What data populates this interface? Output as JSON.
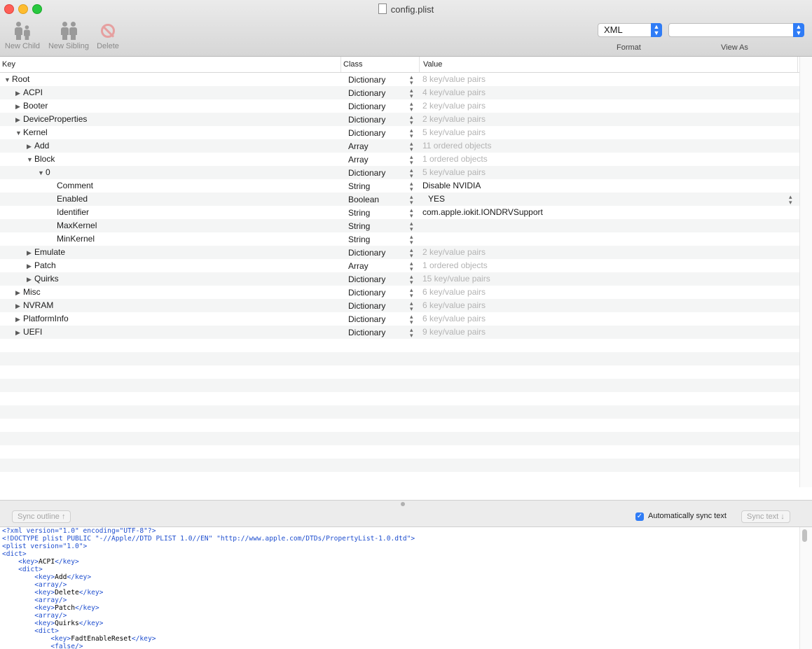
{
  "window": {
    "title": "config.plist"
  },
  "toolbar": {
    "new_child": "New Child",
    "new_sibling": "New Sibling",
    "delete": "Delete",
    "format_value": "XML",
    "format_label": "Format",
    "view_as_value": "",
    "view_as_label": "View As"
  },
  "columns": {
    "key": "Key",
    "class": "Class",
    "value": "Value"
  },
  "rows": [
    {
      "level": 0,
      "disclosure": "open",
      "key": "Root",
      "class": "Dictionary",
      "value": "8 key/value pairs",
      "muted": true
    },
    {
      "level": 1,
      "disclosure": "closed",
      "key": "ACPI",
      "class": "Dictionary",
      "value": "4 key/value pairs",
      "muted": true
    },
    {
      "level": 1,
      "disclosure": "closed",
      "key": "Booter",
      "class": "Dictionary",
      "value": "2 key/value pairs",
      "muted": true
    },
    {
      "level": 1,
      "disclosure": "closed",
      "key": "DeviceProperties",
      "class": "Dictionary",
      "value": "2 key/value pairs",
      "muted": true
    },
    {
      "level": 1,
      "disclosure": "open",
      "key": "Kernel",
      "class": "Dictionary",
      "value": "5 key/value pairs",
      "muted": true
    },
    {
      "level": 2,
      "disclosure": "closed",
      "key": "Add",
      "class": "Array",
      "value": "11 ordered objects",
      "muted": true
    },
    {
      "level": 2,
      "disclosure": "open",
      "key": "Block",
      "class": "Array",
      "value": "1 ordered objects",
      "muted": true
    },
    {
      "level": 3,
      "disclosure": "open",
      "key": "0",
      "class": "Dictionary",
      "value": "5 key/value pairs",
      "muted": true
    },
    {
      "level": 4,
      "disclosure": "none",
      "key": "Comment",
      "class": "String",
      "value": "Disable NVIDIA",
      "muted": false
    },
    {
      "level": 4,
      "disclosure": "none",
      "key": "Enabled",
      "class": "Boolean",
      "value": "YES",
      "muted": false,
      "boolean": true
    },
    {
      "level": 4,
      "disclosure": "none",
      "key": "Identifier",
      "class": "String",
      "value": "com.apple.iokit.IONDRVSupport",
      "muted": false
    },
    {
      "level": 4,
      "disclosure": "none",
      "key": "MaxKernel",
      "class": "String",
      "value": "",
      "muted": false
    },
    {
      "level": 4,
      "disclosure": "none",
      "key": "MinKernel",
      "class": "String",
      "value": "",
      "muted": false
    },
    {
      "level": 2,
      "disclosure": "closed",
      "key": "Emulate",
      "class": "Dictionary",
      "value": "2 key/value pairs",
      "muted": true
    },
    {
      "level": 2,
      "disclosure": "closed",
      "key": "Patch",
      "class": "Array",
      "value": "1 ordered objects",
      "muted": true
    },
    {
      "level": 2,
      "disclosure": "closed",
      "key": "Quirks",
      "class": "Dictionary",
      "value": "15 key/value pairs",
      "muted": true
    },
    {
      "level": 1,
      "disclosure": "closed",
      "key": "Misc",
      "class": "Dictionary",
      "value": "6 key/value pairs",
      "muted": true
    },
    {
      "level": 1,
      "disclosure": "closed",
      "key": "NVRAM",
      "class": "Dictionary",
      "value": "6 key/value pairs",
      "muted": true
    },
    {
      "level": 1,
      "disclosure": "closed",
      "key": "PlatformInfo",
      "class": "Dictionary",
      "value": "6 key/value pairs",
      "muted": true
    },
    {
      "level": 1,
      "disclosure": "closed",
      "key": "UEFI",
      "class": "Dictionary",
      "value": "9 key/value pairs",
      "muted": true
    }
  ],
  "sync": {
    "sync_outline": "Sync outline ↑",
    "auto_sync_label": "Automatically sync text",
    "auto_sync_checked": true,
    "sync_text": "Sync text ↓"
  },
  "xml_lines": [
    "<?xml version=\"1.0\" encoding=\"UTF-8\"?>",
    "<!DOCTYPE plist PUBLIC \"-//Apple//DTD PLIST 1.0//EN\" \"http://www.apple.com/DTDs/PropertyList-1.0.dtd\">",
    "<plist version=\"1.0\">",
    "<dict>",
    "    <key>ACPI</key>",
    "    <dict>",
    "        <key>Add</key>",
    "        <array/>",
    "        <key>Delete</key>",
    "        <array/>",
    "        <key>Patch</key>",
    "        <array/>",
    "        <key>Quirks</key>",
    "        <dict>",
    "            <key>FadtEnableReset</key>",
    "            <false/>"
  ]
}
